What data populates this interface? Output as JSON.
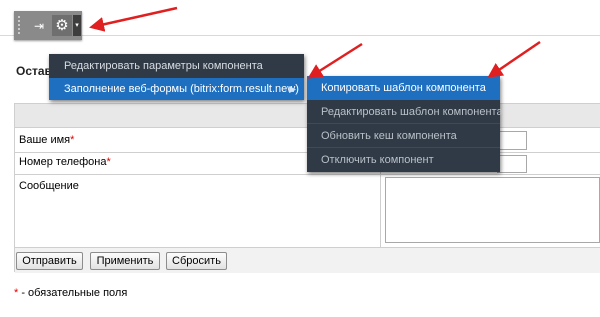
{
  "toolbar": {
    "grip_icon": "drag-handle-icon",
    "pin_icon": "pin-icon",
    "pin_glyph": "⇥",
    "settings_icon": "gear-icon",
    "settings_glyph": "⚙",
    "dropdown_icon": "caret-down-icon",
    "dropdown_glyph": "▾"
  },
  "form": {
    "title": "Оставить заявку",
    "fields": [
      {
        "label": "Ваше имя",
        "required": true
      },
      {
        "label": "Номер телефона",
        "required": true
      },
      {
        "label": "Сообщение",
        "required": false
      }
    ],
    "required_mark": "*",
    "buttons": {
      "submit": "Отправить",
      "apply": "Применить",
      "reset": "Сбросить"
    },
    "required_note_star": "*",
    "required_note_text": " - обязательные поля"
  },
  "menu_main": {
    "items": [
      {
        "label": "Редактировать параметры компонента",
        "active": false
      },
      {
        "label": "Заполнение веб-формы (bitrix:form.result.new)",
        "active": true,
        "has_submenu": true
      }
    ],
    "submenu_glyph": "▶"
  },
  "menu_sub": {
    "items": [
      {
        "label": "Копировать шаблон компонента",
        "active": true
      },
      {
        "label": "Редактировать шаблон компонента",
        "active": false
      },
      {
        "label": "Обновить кеш компонента",
        "active": false
      },
      {
        "label": "Отключить компонент",
        "active": false
      }
    ]
  },
  "colors": {
    "menu_bg": "#2f3a46",
    "menu_highlight": "#1e6fc0",
    "annotation_arrow": "#e02020",
    "required": "#e00000"
  }
}
